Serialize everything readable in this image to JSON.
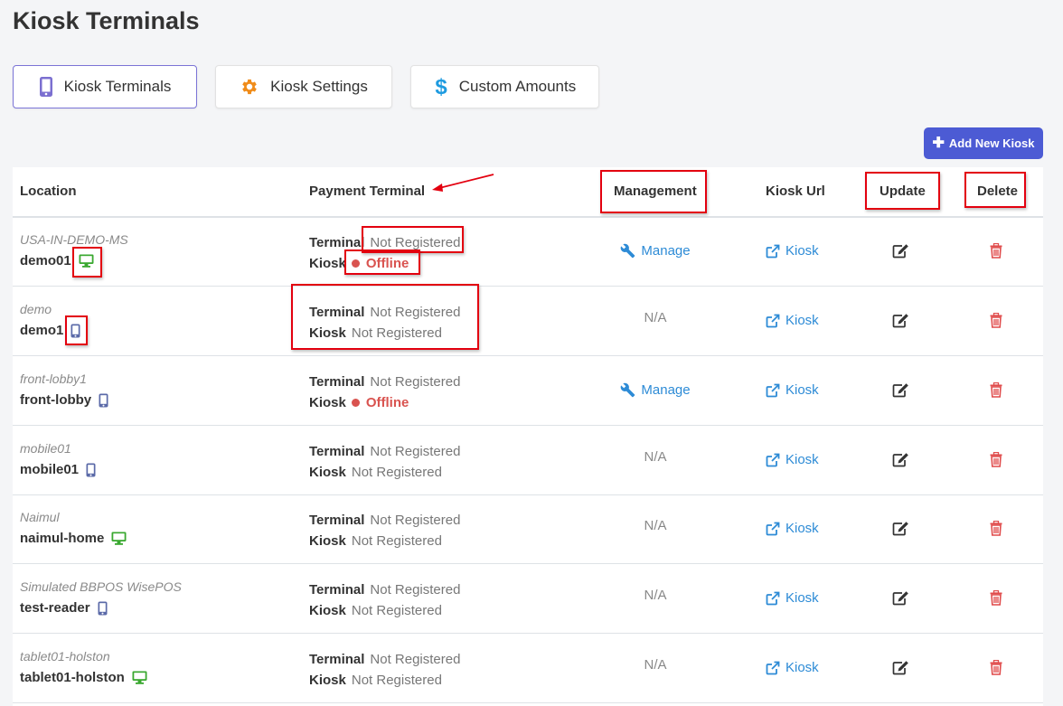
{
  "page_title": "Kiosk Terminals",
  "tabs": [
    {
      "label": "Kiosk Terminals",
      "icon": "tablet-icon",
      "active": true
    },
    {
      "label": "Kiosk Settings",
      "icon": "gear-icon",
      "active": false
    },
    {
      "label": "Custom Amounts",
      "icon": "dollar-icon",
      "active": false
    }
  ],
  "add_button": {
    "label": "Add New Kiosk"
  },
  "table": {
    "headers": {
      "location": "Location",
      "payment_terminal": "Payment Terminal",
      "management": "Management",
      "kiosk_url": "Kiosk Url",
      "update": "Update",
      "delete": "Delete"
    },
    "terminal_label": "Terminal",
    "kiosk_label": "Kiosk",
    "rows": [
      {
        "location_name": "USA-IN-DEMO-MS",
        "location_id": "demo01",
        "device": "desktop",
        "terminal_status": "Not Registered",
        "kiosk_status": "Offline",
        "management": "Manage",
        "kiosk_link": "Kiosk"
      },
      {
        "location_name": "demo",
        "location_id": "demo1",
        "device": "mobile",
        "terminal_status": "Not Registered",
        "kiosk_status": "Not Registered",
        "management": "N/A",
        "kiosk_link": "Kiosk"
      },
      {
        "location_name": "front-lobby1",
        "location_id": "front-lobby",
        "device": "mobile",
        "terminal_status": "Not Registered",
        "kiosk_status": "Offline",
        "management": "Manage",
        "kiosk_link": "Kiosk"
      },
      {
        "location_name": "mobile01",
        "location_id": "mobile01",
        "device": "mobile",
        "terminal_status": "Not Registered",
        "kiosk_status": "Not Registered",
        "management": "N/A",
        "kiosk_link": "Kiosk"
      },
      {
        "location_name": "Naimul",
        "location_id": "naimul-home",
        "device": "desktop",
        "terminal_status": "Not Registered",
        "kiosk_status": "Not Registered",
        "management": "N/A",
        "kiosk_link": "Kiosk"
      },
      {
        "location_name": "Simulated BBPOS WisePOS",
        "location_id": "test-reader",
        "device": "mobile",
        "terminal_status": "Not Registered",
        "kiosk_status": "Not Registered",
        "management": "N/A",
        "kiosk_link": "Kiosk"
      },
      {
        "location_name": "tablet01-holston",
        "location_id": "tablet01-holston",
        "device": "desktop",
        "terminal_status": "Not Registered",
        "kiosk_status": "Not Registered",
        "management": "N/A",
        "kiosk_link": "Kiosk"
      }
    ]
  },
  "colors": {
    "accent": "#4c5bd4",
    "link": "#2d8bd6",
    "offline": "#d9534f",
    "delete": "#e04c4c",
    "desktop_icon": "#3aa830",
    "mobile_icon": "#5b6aa8",
    "annotation": "#e3000f"
  }
}
